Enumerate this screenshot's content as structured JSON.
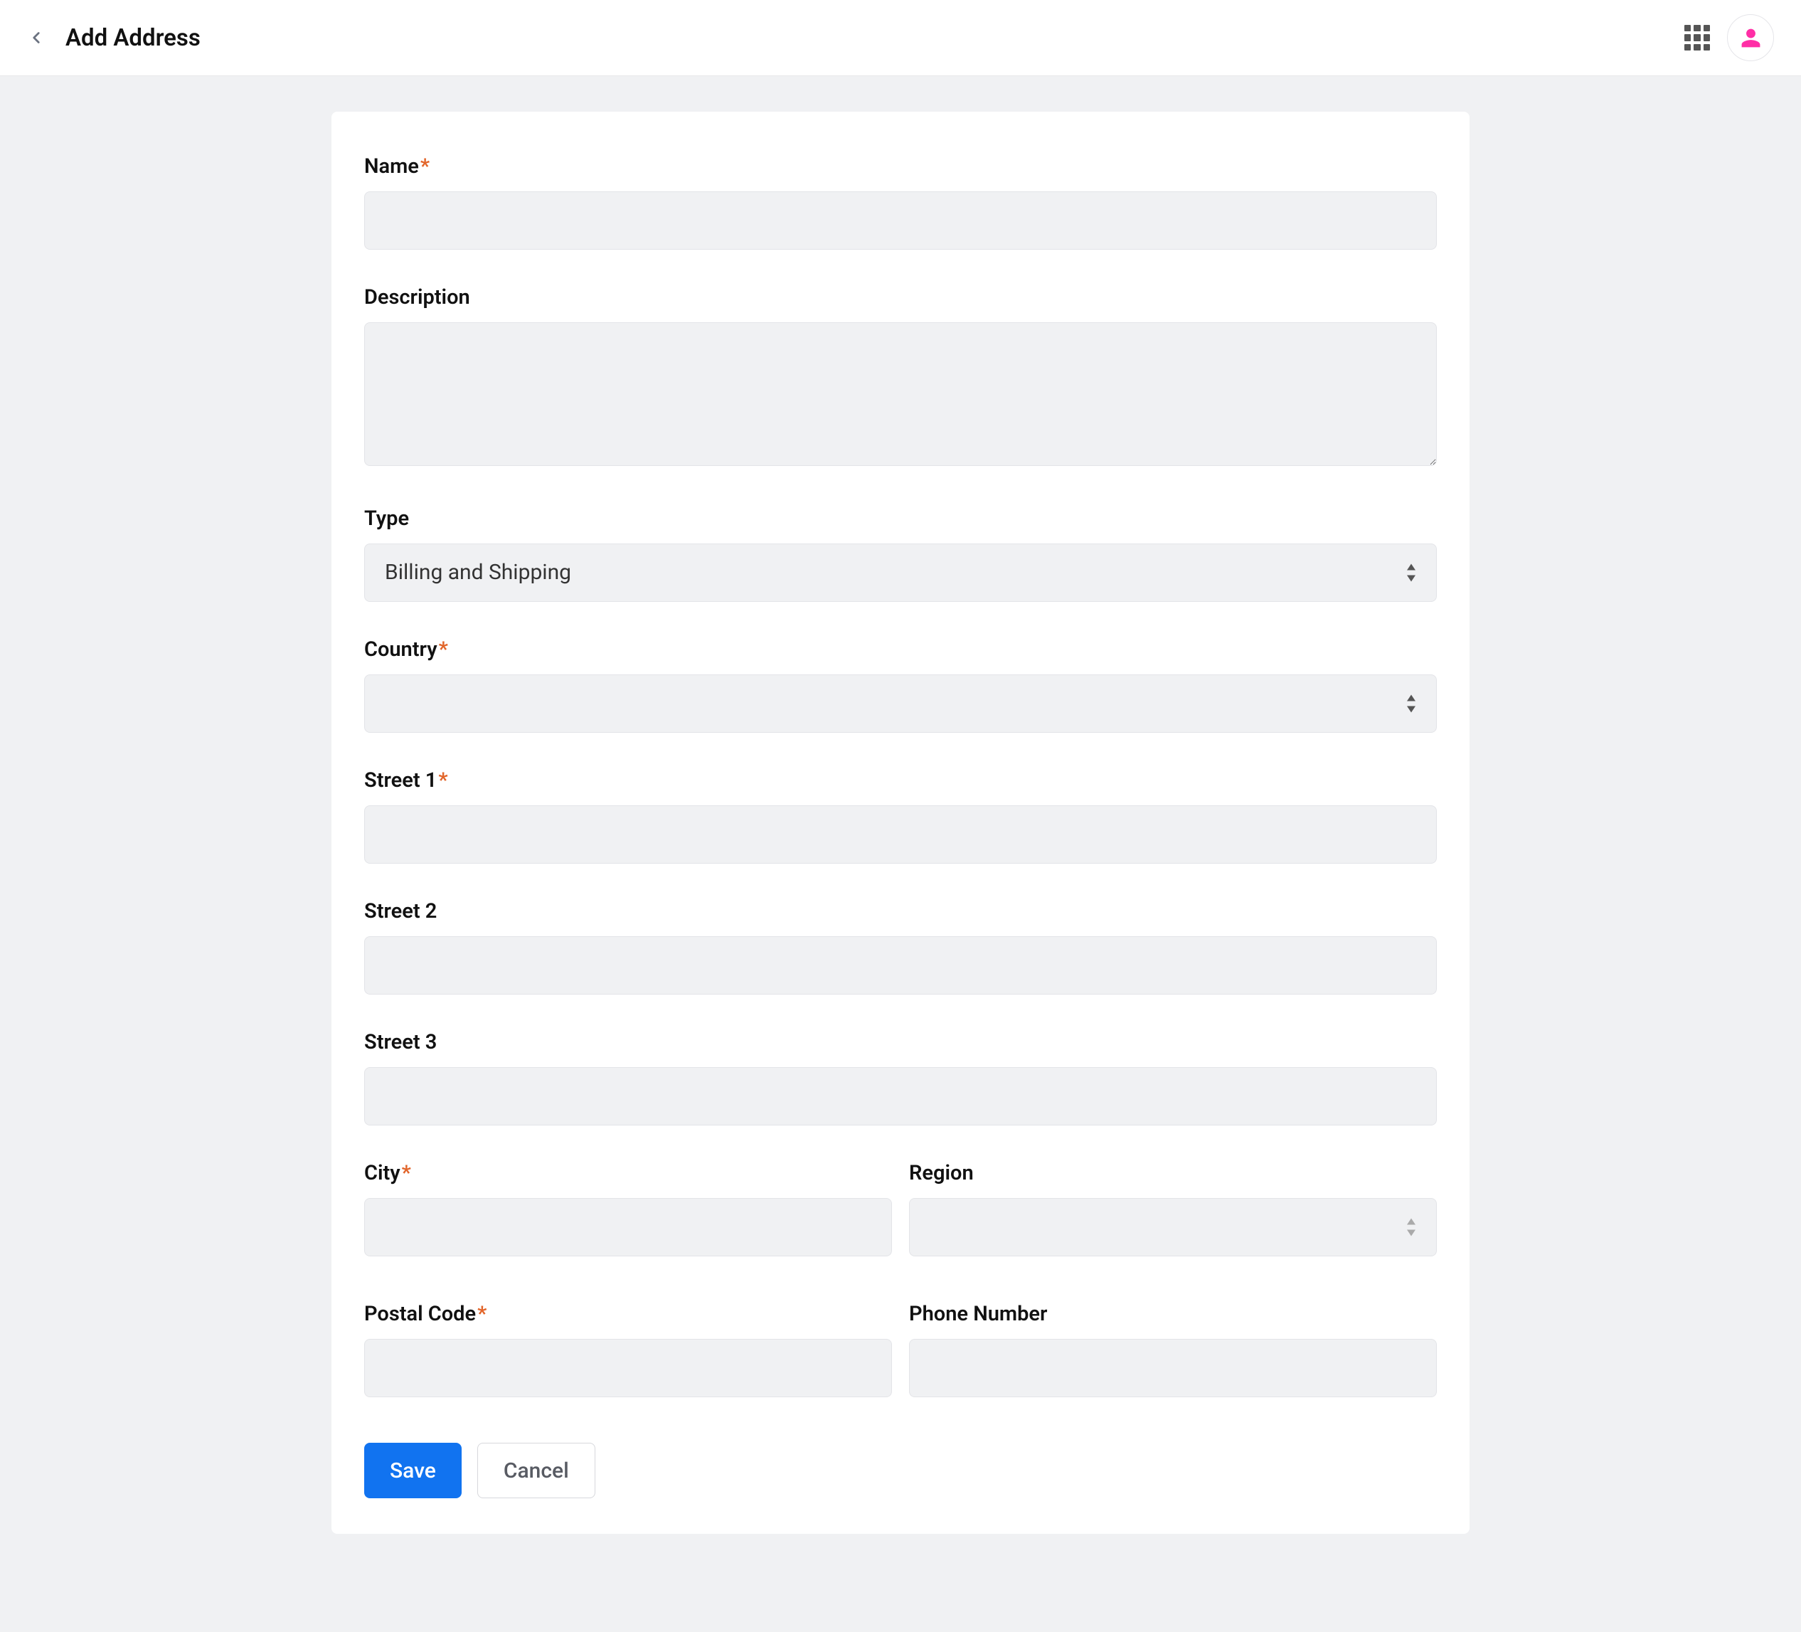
{
  "header": {
    "title": "Add Address"
  },
  "form": {
    "name": {
      "label": "Name",
      "required": true,
      "value": ""
    },
    "description": {
      "label": "Description",
      "required": false,
      "value": ""
    },
    "type": {
      "label": "Type",
      "required": false,
      "value": "Billing and Shipping"
    },
    "country": {
      "label": "Country",
      "required": true,
      "value": ""
    },
    "street1": {
      "label": "Street 1",
      "required": true,
      "value": ""
    },
    "street2": {
      "label": "Street 2",
      "required": false,
      "value": ""
    },
    "street3": {
      "label": "Street 3",
      "required": false,
      "value": ""
    },
    "city": {
      "label": "City",
      "required": true,
      "value": ""
    },
    "region": {
      "label": "Region",
      "required": false,
      "value": ""
    },
    "postal_code": {
      "label": "Postal Code",
      "required": true,
      "value": ""
    },
    "phone": {
      "label": "Phone Number",
      "required": false,
      "value": ""
    }
  },
  "actions": {
    "save": "Save",
    "cancel": "Cancel"
  },
  "required_marker": "*"
}
